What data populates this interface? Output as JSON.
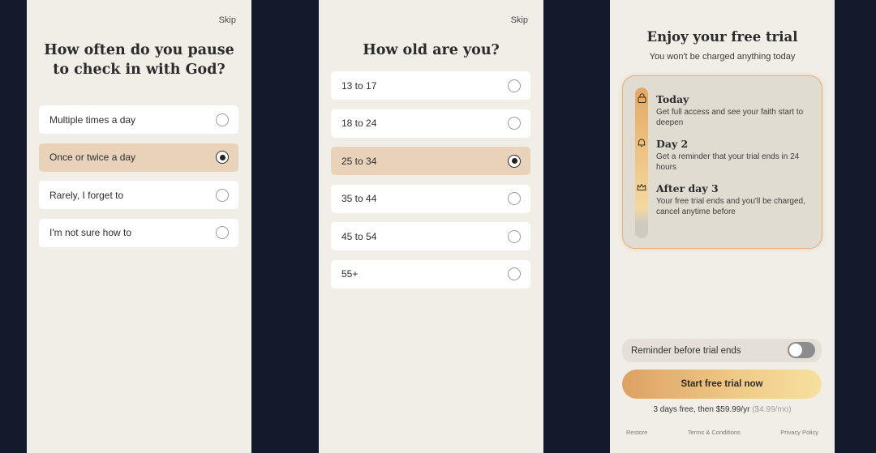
{
  "screen1": {
    "skip": "Skip",
    "title": "How often do you pause to check in with God?",
    "options": [
      {
        "label": "Multiple times a day",
        "selected": false
      },
      {
        "label": "Once or twice a day",
        "selected": true
      },
      {
        "label": "Rarely, I forget to",
        "selected": false
      },
      {
        "label": "I'm not sure how to",
        "selected": false
      }
    ]
  },
  "screen2": {
    "skip": "Skip",
    "title": "How old are you?",
    "options": [
      {
        "label": "13 to 17",
        "selected": false
      },
      {
        "label": "18 to 24",
        "selected": false
      },
      {
        "label": "25 to 34",
        "selected": true
      },
      {
        "label": "35 to 44",
        "selected": false
      },
      {
        "label": "45 to 54",
        "selected": false
      },
      {
        "label": "55+",
        "selected": false
      }
    ]
  },
  "paywall": {
    "title": "Enjoy your free trial",
    "subtitle": "You won't be charged anything today",
    "timeline": [
      {
        "icon": "lock-icon",
        "heading": "Today",
        "description": "Get full access and see your faith start to deepen"
      },
      {
        "icon": "bell-icon",
        "heading": "Day 2",
        "description": "Get a reminder that your trial ends in 24 hours"
      },
      {
        "icon": "crown-icon",
        "heading": "After day 3",
        "description": "Your free trial ends and you'll be charged, cancel anytime before"
      }
    ],
    "reminder_label": "Reminder before trial ends",
    "reminder_on": false,
    "cta_label": "Start free trial now",
    "price_main": "3 days free, then $59.99/yr",
    "price_monthly": "($4.99/mo)",
    "footer": {
      "restore": "Restore",
      "terms": "Terms & Conditions",
      "privacy": "Privacy Policy"
    }
  }
}
